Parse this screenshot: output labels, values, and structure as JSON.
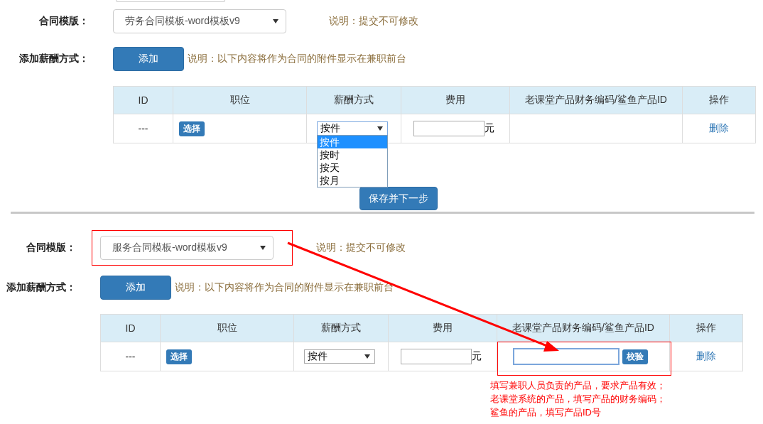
{
  "sections": [
    {
      "top_field_partial": true,
      "template": {
        "label": "合同模版：",
        "value": "劳务合同模板-word模板v9",
        "note": "说明：提交不可修改",
        "highlighted": false
      },
      "pay": {
        "label": "添加薪酬方式：",
        "button": "添加",
        "note": "说明：以下内容将作为合同的附件显示在兼职前台"
      },
      "table": {
        "columns": [
          "ID",
          "职位",
          "薪酬方式",
          "费用",
          "老课堂产品财务编码/鲨鱼产品ID",
          "操作"
        ],
        "rows": [
          {
            "id": "---",
            "position_button": "选择",
            "pay_method": {
              "value": "按件",
              "expanded": true,
              "options": [
                {
                  "label": "按件",
                  "selected": true
                },
                {
                  "label": "按时",
                  "selected": false
                },
                {
                  "label": "按天",
                  "selected": false
                },
                {
                  "label": "按月",
                  "selected": false
                }
              ]
            },
            "fee_unit": "元",
            "product": {
              "kind": "empty"
            },
            "action": "删除"
          }
        ]
      },
      "save_button": "保存并下一步"
    },
    {
      "top_field_partial": false,
      "template": {
        "label": "合同模版：",
        "value": "服务合同模板-word模板v9",
        "note": "说明：提交不可修改",
        "highlighted": true
      },
      "pay": {
        "label": "添加薪酬方式：",
        "button": "添加",
        "note": "说明：以下内容将作为合同的附件显示在兼职前台"
      },
      "table": {
        "columns": [
          "ID",
          "职位",
          "薪酬方式",
          "费用",
          "老课堂产品财务编码/鲨鱼产品ID",
          "操作"
        ],
        "rows": [
          {
            "id": "---",
            "position_button": "选择",
            "pay_method": {
              "value": "按件",
              "expanded": false
            },
            "fee_unit": "元",
            "product": {
              "kind": "verify",
              "focused": true,
              "button": "校验",
              "highlighted": true
            },
            "action": "删除"
          }
        ]
      },
      "annotation_lines": [
        "填写兼职人员负责的产品，要求产品有效；",
        "老课堂系统的产品，填写产品的财务编码；",
        "鲨鱼的产品，填写产品ID号"
      ]
    }
  ],
  "arrow": true
}
